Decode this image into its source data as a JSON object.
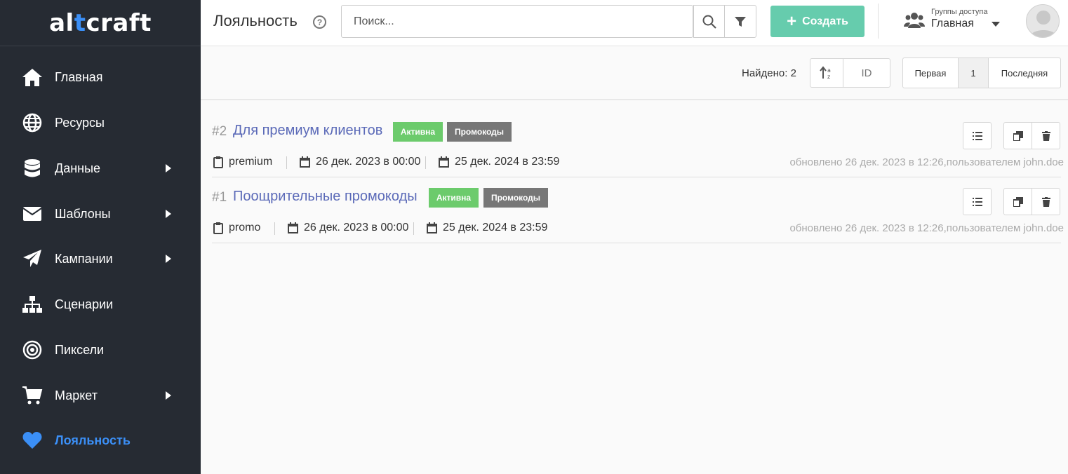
{
  "brand": {
    "logo_prefix": "al",
    "logo_accent": "t",
    "logo_suffix": "craft"
  },
  "sidebar": {
    "items": [
      {
        "label": "Главная",
        "icon": "home-icon",
        "has_submenu": false
      },
      {
        "label": "Ресурсы",
        "icon": "globe-icon",
        "has_submenu": false
      },
      {
        "label": "Данные",
        "icon": "database-icon",
        "has_submenu": true
      },
      {
        "label": "Шаблоны",
        "icon": "envelope-icon",
        "has_submenu": true
      },
      {
        "label": "Кампании",
        "icon": "paper-plane-icon",
        "has_submenu": true
      },
      {
        "label": "Сценарии",
        "icon": "sitemap-icon",
        "has_submenu": false
      },
      {
        "label": "Пиксели",
        "icon": "target-icon",
        "has_submenu": false
      },
      {
        "label": "Маркет",
        "icon": "cart-icon",
        "has_submenu": true
      },
      {
        "label": "Лояльность",
        "icon": "heart-icon",
        "has_submenu": false,
        "active": true
      }
    ]
  },
  "header": {
    "title": "Лояльность",
    "help_glyph": "?",
    "search_placeholder": "Поиск...",
    "create_label": "Создать",
    "access_caption": "Группы доступа",
    "access_value": "Главная"
  },
  "toolbar": {
    "found": "Найдено: 2",
    "sort_field": "ID",
    "pager": {
      "first": "Первая",
      "current": "1",
      "last": "Последняя"
    }
  },
  "rows": [
    {
      "id": "#2",
      "title": "Для премиум клиентов",
      "status": "Активна",
      "type": "Промокоды",
      "code": "premium",
      "start": "26 дек. 2023 в 00:00",
      "end": "25 дек. 2024 в 23:59",
      "updated": "обновлено 26 дек. 2023 в 12:26,пользователем john.doe"
    },
    {
      "id": "#1",
      "title": "Поощрительные промокоды",
      "status": "Активна",
      "type": "Промокоды",
      "code": "promo",
      "start": "26 дек. 2023 в 00:00",
      "end": "25 дек. 2024 в 23:59",
      "updated": "обновлено 26 дек. 2023 в 12:26,пользователем john.doe"
    }
  ],
  "colors": {
    "sidebar_bg": "#262b33",
    "accent_blue": "#3b8ff6",
    "create_green": "#66ccad",
    "badge_active": "#6ccb6c",
    "badge_type": "#777777",
    "link": "#5b6ab8"
  }
}
